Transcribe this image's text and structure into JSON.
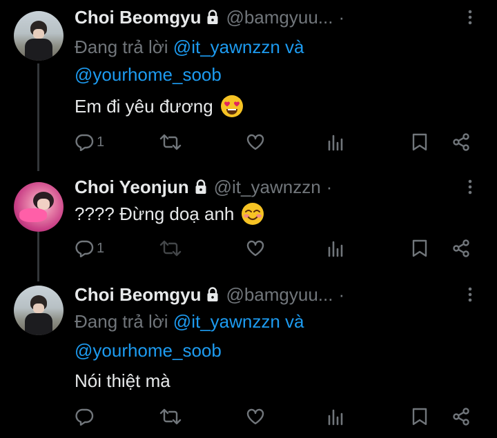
{
  "tweets": [
    {
      "author": "Choi Beomgyu",
      "handle": "@bamgyuu...",
      "separator": "·",
      "reply_prefix": "Đang trả lời",
      "mention1": "@it_yawnzzn",
      "reply_joiner": "và",
      "mention2": "@yourhome_soob",
      "text": "Em đi yêu đương",
      "emoji": "heart-eyes-emoji",
      "reply_count": "1"
    },
    {
      "author": "Choi Yeonjun",
      "handle": "@it_yawnzzn",
      "separator": "·",
      "text": "???? Đừng doạ anh",
      "emoji": "smiling-blush-emoji",
      "reply_count": "1"
    },
    {
      "author": "Choi Beomgyu",
      "handle": "@bamgyuu...",
      "separator": "·",
      "reply_prefix": "Đang trả lời",
      "mention1": "@it_yawnzzn",
      "reply_joiner": "và",
      "mention2": "@yourhome_soob",
      "text": "Nói thiệt mà",
      "reply_count": ""
    }
  ],
  "colors": {
    "background": "#000000",
    "text": "#e7e9ea",
    "secondary": "#71767b",
    "link": "#1d9bf0",
    "thread_line": "#333639"
  }
}
